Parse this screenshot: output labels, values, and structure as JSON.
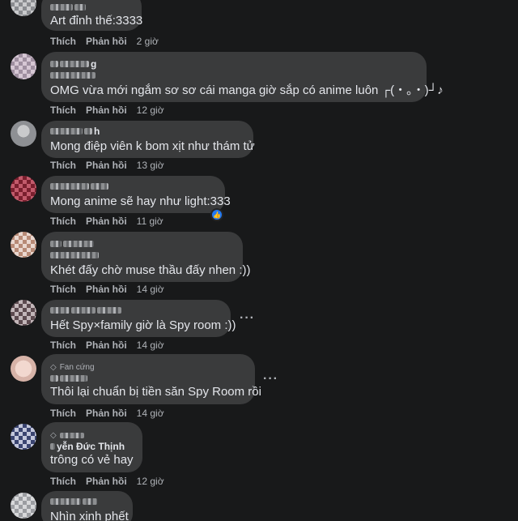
{
  "actions": {
    "like": "Thích",
    "reply": "Phản hồi"
  },
  "comments": [
    {
      "text": "Art đỉnh thế:3333",
      "time": "2 giờ"
    },
    {
      "text": "OMG vừa mới ngắm sơ sơ cái manga giờ sắp có anime luôn ┌(・。・)┘♪",
      "time": "12 giờ"
    },
    {
      "text": "Mong điệp viên k bom xịt như thám tử",
      "time": "13 giờ"
    },
    {
      "text": "Mong anime sẽ hay như light:333",
      "time": "11 giờ"
    },
    {
      "text": "Khét đấy chờ muse thầu đấy nhen :))",
      "time": "14 giờ"
    },
    {
      "text": "Hết Spy×family giờ là Spy room :))",
      "time": "14 giờ"
    },
    {
      "badge": "Fan cứng",
      "text": "Thôi lại chuẩn bị tiền săn Spy Room rồi",
      "time": "14 giờ"
    },
    {
      "name_partial": "yễn Đức Thịnh",
      "text": "trông có vẻ hay",
      "time": "12 giờ"
    },
    {
      "text": "Nhìn xinh phết"
    }
  ],
  "colors": {
    "background": "#18191a",
    "bubble": "#3a3b3c",
    "text": "#e4e6eb",
    "secondary": "#b0b3b8",
    "like_blue": "#2078f4"
  },
  "icons": {
    "more": "more-horizontal-icon",
    "fan_badge": "diamond-icon",
    "like_reaction": "thumbs-up-icon"
  }
}
